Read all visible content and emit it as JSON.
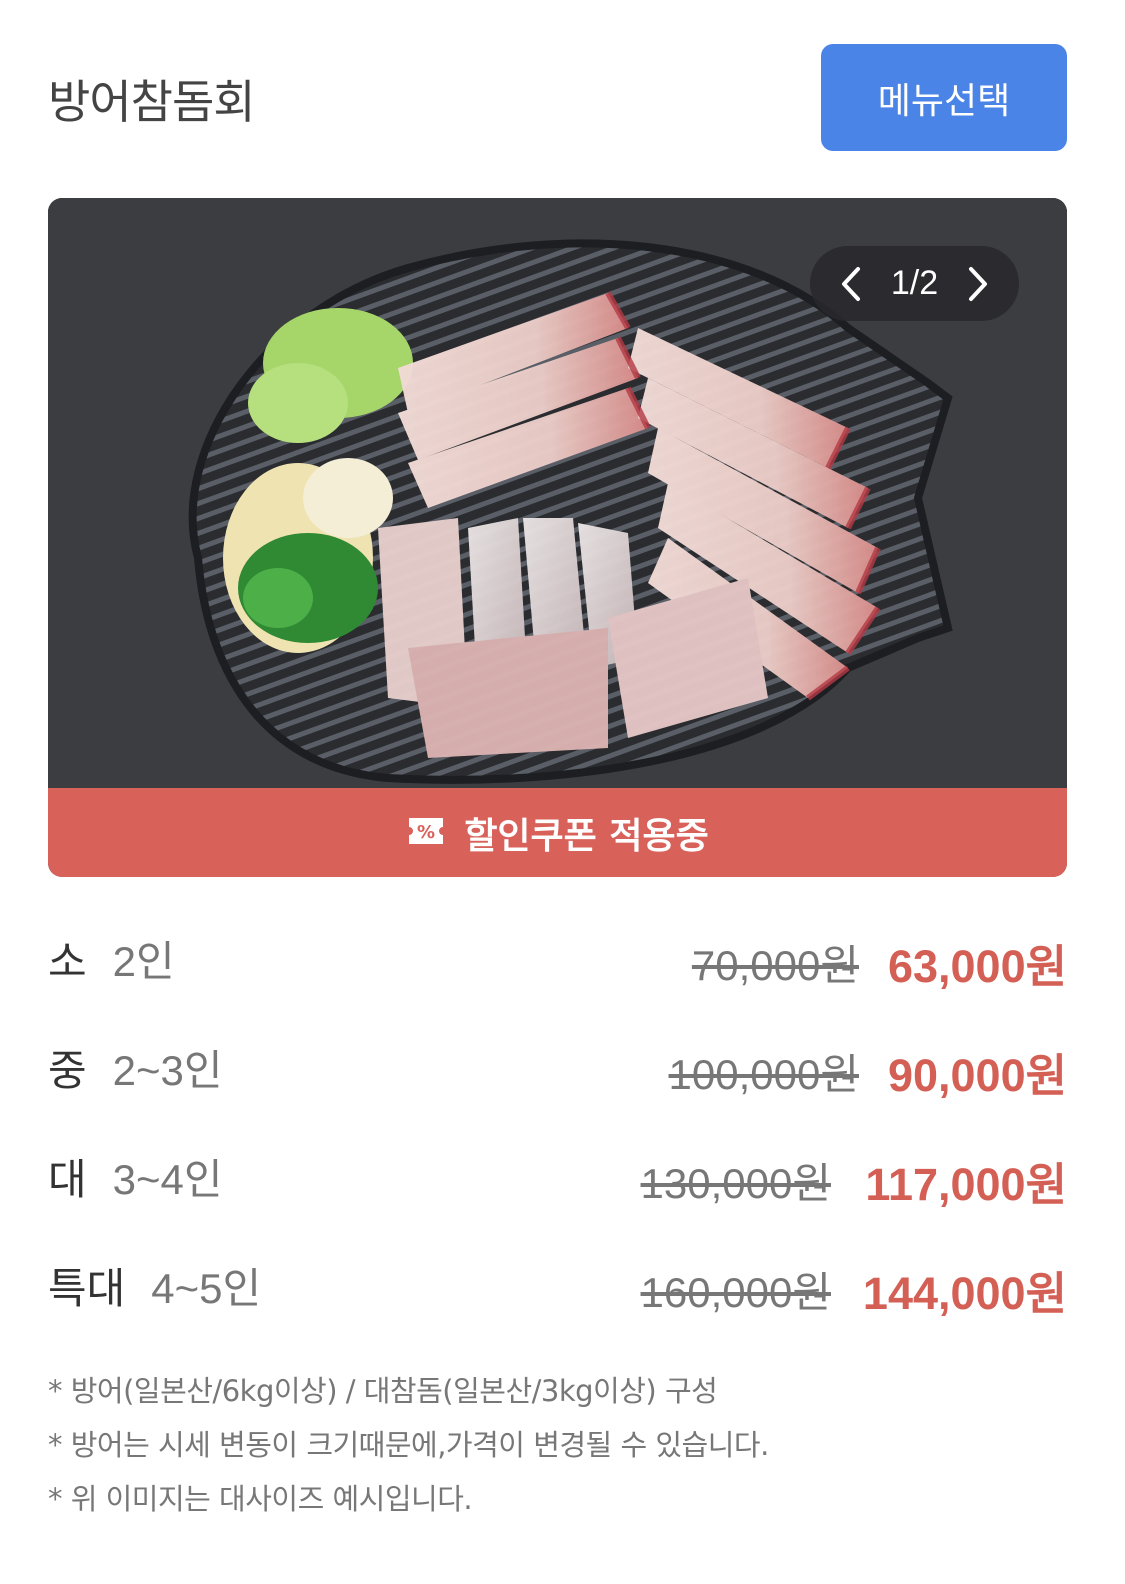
{
  "header": {
    "title": "방어참돔회",
    "menu_button_label": "메뉴선택"
  },
  "gallery": {
    "pager_text": "1/2",
    "prev_icon": "chevron-left-icon",
    "next_icon": "chevron-right-icon"
  },
  "coupon": {
    "label": "할인쿠폰 적용중",
    "icon": "coupon-icon"
  },
  "prices": [
    {
      "size": "소",
      "people": "2인",
      "original": "70,000원",
      "sale": "63,000원"
    },
    {
      "size": "중",
      "people": "2~3인",
      "original": "100,000원",
      "sale": "90,000원"
    },
    {
      "size": "대",
      "people": "3~4인",
      "original": "130,000원",
      "sale": "117,000원"
    },
    {
      "size": "특대",
      "people": "4~5인",
      "original": "160,000원",
      "sale": "144,000원"
    }
  ],
  "notes": [
    "* 방어(일본산/6kg이상) / 대참돔(일본산/3kg이상) 구성",
    "* 방어는 시세 변동이 크기때문에,가격이 변경될 수 있습니다.",
    "* 위 이미지는 대사이즈 예시입니다."
  ],
  "colors": {
    "accent_blue": "#4a84e6",
    "coupon_red": "#d8615a",
    "sale_red": "#d45f55"
  }
}
